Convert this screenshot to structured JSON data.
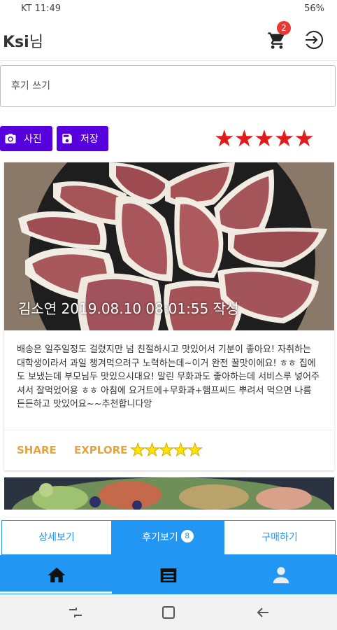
{
  "status_bar": {
    "carrier_time": "KT 11:49",
    "right_text": "56%"
  },
  "header": {
    "user_name": "Ksi",
    "suffix": "님",
    "cart_count": "2",
    "cart_icon": "cart-icon",
    "logout_icon": "logout-icon"
  },
  "review_input": {
    "placeholder": "후기 쓰기"
  },
  "buttons": {
    "photo_label": "사진",
    "save_label": "저장"
  },
  "rating_input": {
    "stars": "★★★★★",
    "value": 5,
    "max": 5,
    "color": "#e21b1b"
  },
  "review_card": {
    "caption": "김소연    2019.08.10 08:01:55 작성",
    "text": "배송은 일주일정도 걸렸지만 넘 친절하시고 맛있어서 기분이 좋아요! 자취하는 대학생이라서 과일 챙겨먹으려구 노력하는데~이거 완전 꿀맛이에요! ㅎㅎ 집에도 보냈는데 부모님두 맛있으시대요! 말린 무화과도 좋아하는데 서비스루 넣어주셔서 잘먹었어용 ㅎㅎ 아침에 요거트에+무화과+햄프씨드 뿌려서 먹으면 나름 든든하고 맛있어요~~추천합니다앙",
    "share_label": "SHARE",
    "explore_label": "EXPLORE",
    "stars": "★★★★★",
    "rating": 5,
    "star_color": "#ffe600"
  },
  "tabs": {
    "detail_label": "상세보기",
    "review_label": "후기보기",
    "review_count": "8",
    "buy_label": "구매하기"
  },
  "bottom_nav": {
    "home_icon": "home-icon",
    "list_icon": "list-icon",
    "profile_icon": "profile-icon",
    "accent": "#2196f3"
  }
}
